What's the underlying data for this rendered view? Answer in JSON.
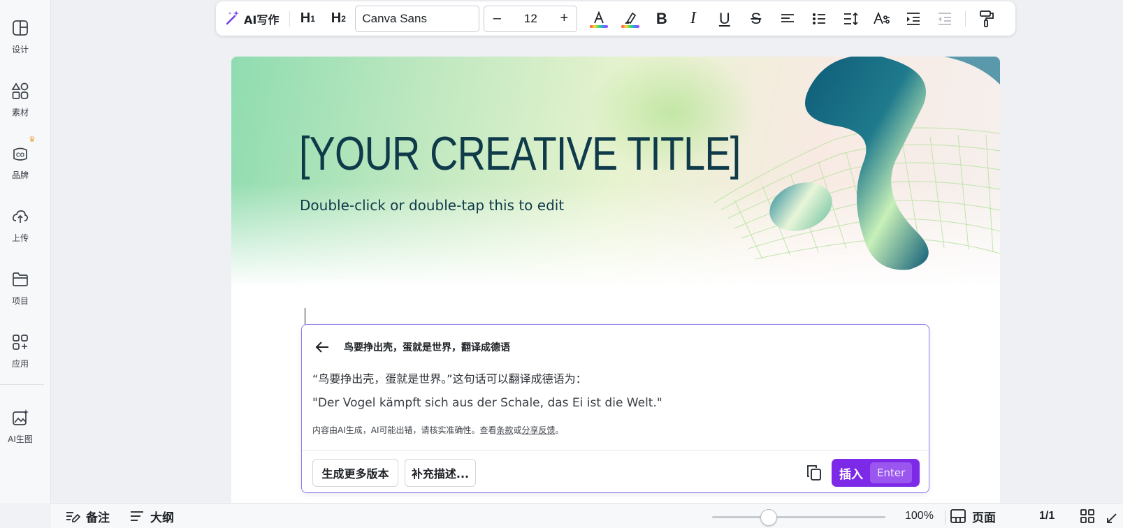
{
  "sidebar": {
    "items": [
      {
        "label": "设计",
        "icon": "layout-icon"
      },
      {
        "label": "素材",
        "icon": "elements-icon"
      },
      {
        "label": "品牌",
        "icon": "brand-icon"
      },
      {
        "label": "上传",
        "icon": "upload-cloud-icon"
      },
      {
        "label": "项目",
        "icon": "folder-icon"
      },
      {
        "label": "应用",
        "icon": "apps-grid-icon"
      },
      {
        "label": "AI生图",
        "icon": "ai-image-icon"
      }
    ]
  },
  "toolbar": {
    "ai_write": "AI写作",
    "h1": "H",
    "h1_sub": "1",
    "h2": "H",
    "h2_sub": "2",
    "font": "Canva Sans",
    "font_size": "12",
    "minus": "–",
    "plus": "+"
  },
  "slide": {
    "title": "[YOUR CREATIVE TITLE]",
    "subtitle": "Double-click or double-tap this to edit"
  },
  "ai_panel": {
    "prompt": "鸟要挣出壳，蛋就是世界，翻译成德语",
    "response_line1": "“鸟要挣出壳，蛋就是世界。”这句话可以翻译成德语为：",
    "response_line2": "\"Der Vogel kämpft sich aus der Schale, das Ei ist die Welt.\"",
    "disclaimer_prefix": "内容由AI生成，AI可能出错，请核实准确性。查看",
    "terms_link": "条款",
    "or_text": "或",
    "feedback_link": "分享反馈",
    "period": "。",
    "more_versions": "生成更多版本",
    "add_description": "补充描述...",
    "insert": "插入",
    "insert_key": "Enter"
  },
  "bottom_bar": {
    "notes": "备注",
    "outline": "大纲",
    "zoom_percent": 0.1,
    "zoom": "100%",
    "pages_label": "页面",
    "page_count": "1/1"
  },
  "colors": {
    "accent": "#7d2ae8",
    "title": "#0f3a4a",
    "panel_border": "#8b7df0"
  }
}
